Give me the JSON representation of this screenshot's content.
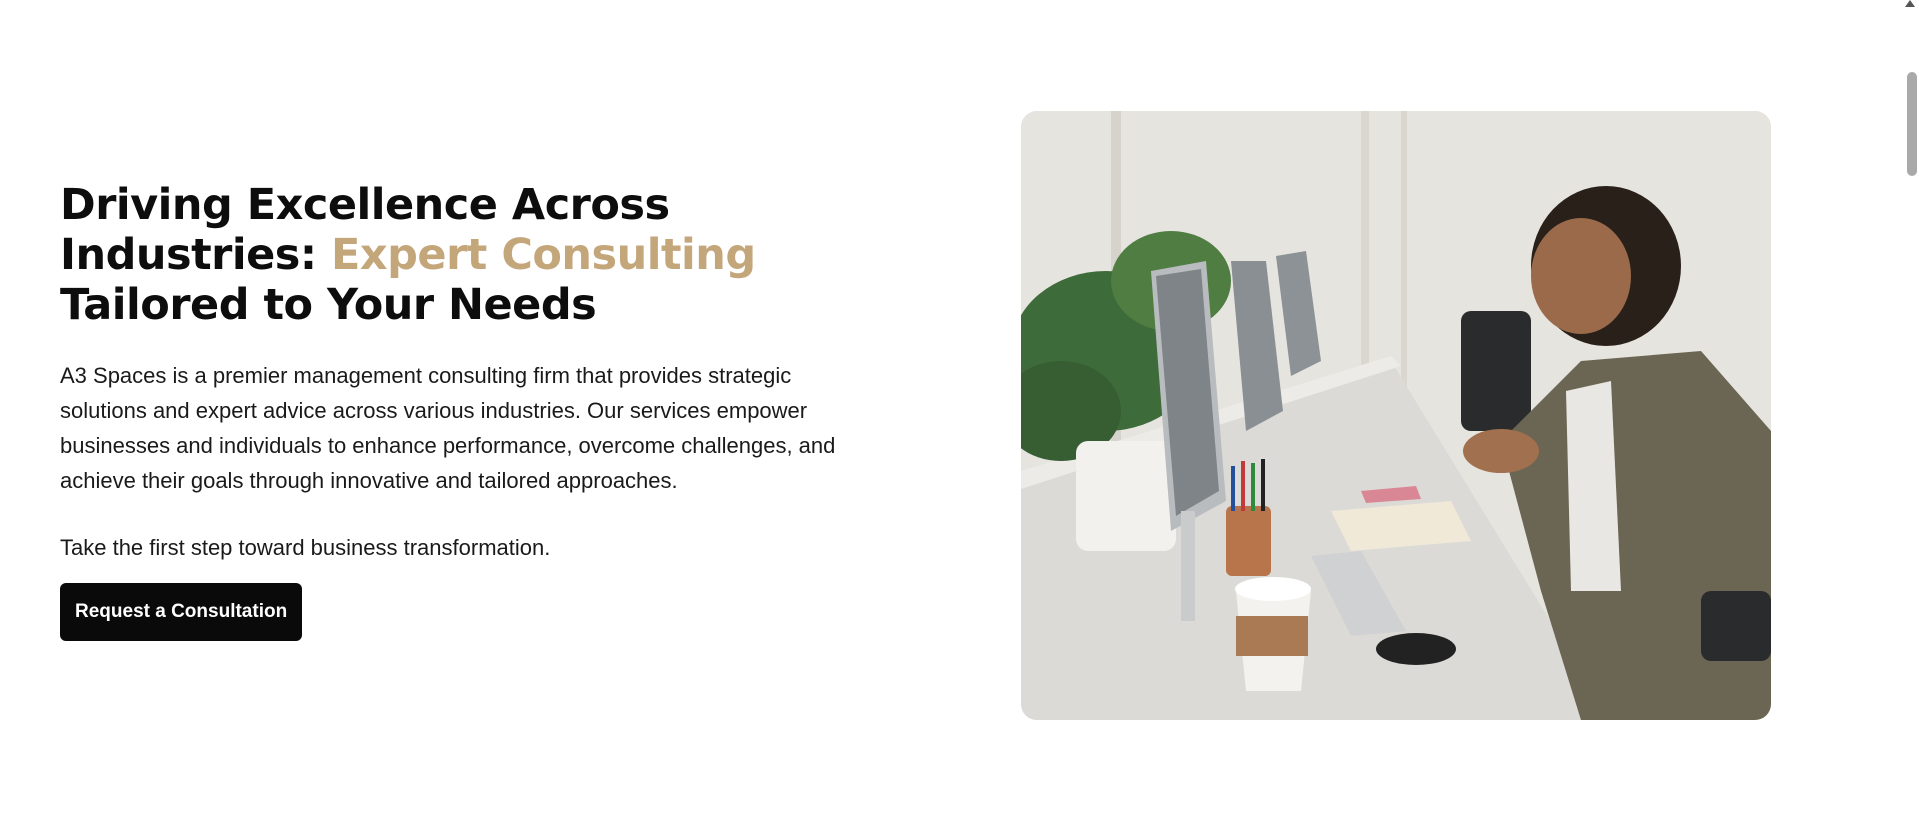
{
  "hero": {
    "headline_part1": "Driving Excellence Across Industries: ",
    "headline_accent": "Expert Consulting",
    "headline_part2": " Tailored to Your Needs",
    "description": "A3 Spaces is a premier management consulting firm that provides strategic solutions and expert advice across various industries. Our services empower businesses and individuals to enhance performance, overcome challenges, and achieve their goals through innovative and tailored approaches.",
    "cta_text": "Take the first step toward business transformation.",
    "cta_button_label": "Request a Consultation"
  },
  "colors": {
    "accent": "#c4a67b",
    "button_bg": "#0a0a0a",
    "text": "#111111"
  },
  "image": {
    "subject": "person-laughing-at-office-desk-photo"
  },
  "icons": {
    "scroll_up": "scroll-up-arrow-icon"
  }
}
